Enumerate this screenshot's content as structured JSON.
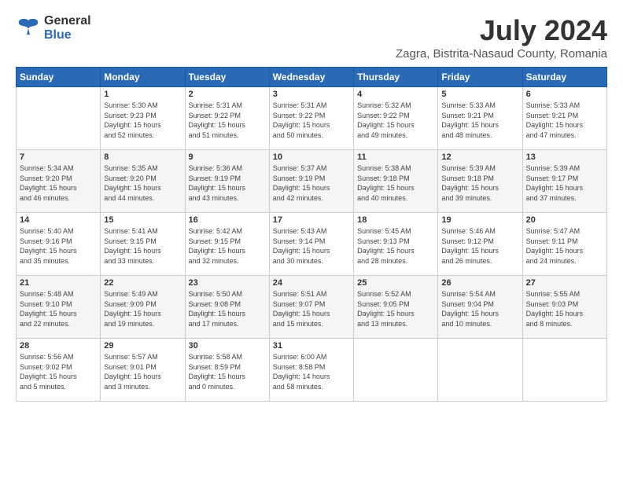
{
  "logo": {
    "general": "General",
    "blue": "Blue"
  },
  "title": "July 2024",
  "subtitle": "Zagra, Bistrita-Nasaud County, Romania",
  "weekdays": [
    "Sunday",
    "Monday",
    "Tuesday",
    "Wednesday",
    "Thursday",
    "Friday",
    "Saturday"
  ],
  "weeks": [
    [
      {
        "day": "",
        "info": ""
      },
      {
        "day": "1",
        "info": "Sunrise: 5:30 AM\nSunset: 9:23 PM\nDaylight: 15 hours\nand 52 minutes."
      },
      {
        "day": "2",
        "info": "Sunrise: 5:31 AM\nSunset: 9:22 PM\nDaylight: 15 hours\nand 51 minutes."
      },
      {
        "day": "3",
        "info": "Sunrise: 5:31 AM\nSunset: 9:22 PM\nDaylight: 15 hours\nand 50 minutes."
      },
      {
        "day": "4",
        "info": "Sunrise: 5:32 AM\nSunset: 9:22 PM\nDaylight: 15 hours\nand 49 minutes."
      },
      {
        "day": "5",
        "info": "Sunrise: 5:33 AM\nSunset: 9:21 PM\nDaylight: 15 hours\nand 48 minutes."
      },
      {
        "day": "6",
        "info": "Sunrise: 5:33 AM\nSunset: 9:21 PM\nDaylight: 15 hours\nand 47 minutes."
      }
    ],
    [
      {
        "day": "7",
        "info": "Sunrise: 5:34 AM\nSunset: 9:20 PM\nDaylight: 15 hours\nand 46 minutes."
      },
      {
        "day": "8",
        "info": "Sunrise: 5:35 AM\nSunset: 9:20 PM\nDaylight: 15 hours\nand 44 minutes."
      },
      {
        "day": "9",
        "info": "Sunrise: 5:36 AM\nSunset: 9:19 PM\nDaylight: 15 hours\nand 43 minutes."
      },
      {
        "day": "10",
        "info": "Sunrise: 5:37 AM\nSunset: 9:19 PM\nDaylight: 15 hours\nand 42 minutes."
      },
      {
        "day": "11",
        "info": "Sunrise: 5:38 AM\nSunset: 9:18 PM\nDaylight: 15 hours\nand 40 minutes."
      },
      {
        "day": "12",
        "info": "Sunrise: 5:39 AM\nSunset: 9:18 PM\nDaylight: 15 hours\nand 39 minutes."
      },
      {
        "day": "13",
        "info": "Sunrise: 5:39 AM\nSunset: 9:17 PM\nDaylight: 15 hours\nand 37 minutes."
      }
    ],
    [
      {
        "day": "14",
        "info": "Sunrise: 5:40 AM\nSunset: 9:16 PM\nDaylight: 15 hours\nand 35 minutes."
      },
      {
        "day": "15",
        "info": "Sunrise: 5:41 AM\nSunset: 9:15 PM\nDaylight: 15 hours\nand 33 minutes."
      },
      {
        "day": "16",
        "info": "Sunrise: 5:42 AM\nSunset: 9:15 PM\nDaylight: 15 hours\nand 32 minutes."
      },
      {
        "day": "17",
        "info": "Sunrise: 5:43 AM\nSunset: 9:14 PM\nDaylight: 15 hours\nand 30 minutes."
      },
      {
        "day": "18",
        "info": "Sunrise: 5:45 AM\nSunset: 9:13 PM\nDaylight: 15 hours\nand 28 minutes."
      },
      {
        "day": "19",
        "info": "Sunrise: 5:46 AM\nSunset: 9:12 PM\nDaylight: 15 hours\nand 26 minutes."
      },
      {
        "day": "20",
        "info": "Sunrise: 5:47 AM\nSunset: 9:11 PM\nDaylight: 15 hours\nand 24 minutes."
      }
    ],
    [
      {
        "day": "21",
        "info": "Sunrise: 5:48 AM\nSunset: 9:10 PM\nDaylight: 15 hours\nand 22 minutes."
      },
      {
        "day": "22",
        "info": "Sunrise: 5:49 AM\nSunset: 9:09 PM\nDaylight: 15 hours\nand 19 minutes."
      },
      {
        "day": "23",
        "info": "Sunrise: 5:50 AM\nSunset: 9:08 PM\nDaylight: 15 hours\nand 17 minutes."
      },
      {
        "day": "24",
        "info": "Sunrise: 5:51 AM\nSunset: 9:07 PM\nDaylight: 15 hours\nand 15 minutes."
      },
      {
        "day": "25",
        "info": "Sunrise: 5:52 AM\nSunset: 9:05 PM\nDaylight: 15 hours\nand 13 minutes."
      },
      {
        "day": "26",
        "info": "Sunrise: 5:54 AM\nSunset: 9:04 PM\nDaylight: 15 hours\nand 10 minutes."
      },
      {
        "day": "27",
        "info": "Sunrise: 5:55 AM\nSunset: 9:03 PM\nDaylight: 15 hours\nand 8 minutes."
      }
    ],
    [
      {
        "day": "28",
        "info": "Sunrise: 5:56 AM\nSunset: 9:02 PM\nDaylight: 15 hours\nand 5 minutes."
      },
      {
        "day": "29",
        "info": "Sunrise: 5:57 AM\nSunset: 9:01 PM\nDaylight: 15 hours\nand 3 minutes."
      },
      {
        "day": "30",
        "info": "Sunrise: 5:58 AM\nSunset: 8:59 PM\nDaylight: 15 hours\nand 0 minutes."
      },
      {
        "day": "31",
        "info": "Sunrise: 6:00 AM\nSunset: 8:58 PM\nDaylight: 14 hours\nand 58 minutes."
      },
      {
        "day": "",
        "info": ""
      },
      {
        "day": "",
        "info": ""
      },
      {
        "day": "",
        "info": ""
      }
    ]
  ]
}
